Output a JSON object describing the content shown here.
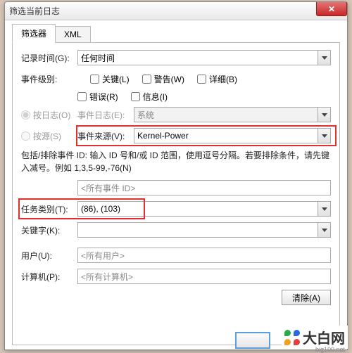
{
  "title": "筛选当前日志",
  "tabs": {
    "filter": "筛选器",
    "xml": "XML"
  },
  "labels": {
    "recordTime": "记录时间(G):",
    "eventLevel": "事件级别:",
    "byLog": "按日志(O)",
    "eventLog": "事件日志(E):",
    "bySource": "按源(S)",
    "eventSource": "事件来源(V):",
    "note": "包括/排除事件 ID: 输入 ID 号和/或 ID 范围，使用逗号分隔。若要排除条件，请先键入减号。例如 1,3,5-99,-76(N)",
    "taskCategory": "任务类别(T):",
    "keyword": "关键字(K):",
    "user": "用户(U):",
    "computer": "计算机(P):"
  },
  "values": {
    "recordTime": "任何时间",
    "eventLog": "系统",
    "eventSource": "Kernel-Power",
    "eventId": "<所有事件 ID>",
    "taskCategory": "(86), (103)",
    "user": "<所有用户>",
    "computer": "<所有计算机>"
  },
  "checkboxes": {
    "critical": "关键(L)",
    "warning": "警告(W)",
    "verbose": "详细(B)",
    "error": "错误(R)",
    "info": "信息(I)"
  },
  "buttons": {
    "clear": "清除(A)"
  },
  "watermark": {
    "text": "大白网",
    "sub": "big100.net"
  }
}
